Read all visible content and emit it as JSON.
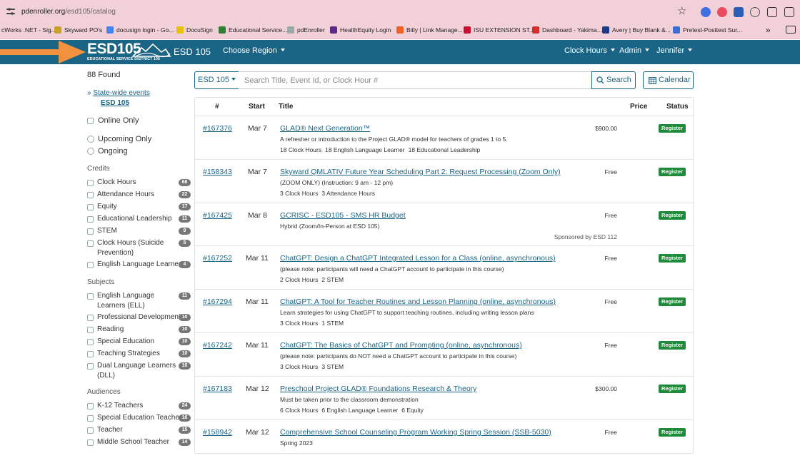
{
  "browser": {
    "url_host": "pdenroller.org",
    "url_path": "/esd105/catalog",
    "bookmarks": [
      {
        "label": "cWorks .NET - Sig...",
        "color": "#666"
      },
      {
        "label": "Skyward PO's",
        "color": "#c8a02a"
      },
      {
        "label": "docusign login - Go...",
        "color": "#4285f4"
      },
      {
        "label": "DocuSign",
        "color": "#e6c200"
      },
      {
        "label": "Educational Service...",
        "color": "#2e7d32"
      },
      {
        "label": "pdEnroller",
        "color": "#9aa"
      },
      {
        "label": "HealthEquity Login",
        "color": "#5b2a86"
      },
      {
        "label": "Bitly | Link Manage...",
        "color": "#ee6123"
      },
      {
        "label": "ISU EXTENSION ST...",
        "color": "#c8102e"
      },
      {
        "label": "Dashboard - Yakima...",
        "color": "#d32f2f"
      },
      {
        "label": "Avery | Buy Blank &...",
        "color": "#1b3a8a"
      },
      {
        "label": "Pretest-Posttest Sur...",
        "color": "#3b6fd6"
      }
    ]
  },
  "nav": {
    "logo_text": "ESD105",
    "logo_subtitle": "EDUCATIONAL SERVICE DISTRICT 105",
    "brand": "ESD 105",
    "choose_region": "Choose Region",
    "clock_hours": "Clock Hours",
    "admin": "Admin",
    "user": "Jennifer"
  },
  "sidebar": {
    "found": "88 Found",
    "statewide": "State-wide events",
    "esd105": "ESD 105",
    "online_only": "Online Only",
    "upcoming_only": "Upcoming Only",
    "ongoing": "Ongoing",
    "credits_title": "Credits",
    "credits": [
      {
        "label": "Clock Hours",
        "count": "68"
      },
      {
        "label": "Attendance Hours",
        "count": "22"
      },
      {
        "label": "Equity",
        "count": "17"
      },
      {
        "label": "Educational Leadership",
        "count": "11"
      },
      {
        "label": "STEM",
        "count": "9"
      },
      {
        "label": "Clock Hours (Suicide",
        "label2": "Prevention)",
        "count": "5"
      },
      {
        "label": "English Language Learner",
        "count": "4"
      }
    ],
    "subjects_title": "Subjects",
    "subjects": [
      {
        "label": "English Language",
        "label2": "Learners (ELL)",
        "count": "11"
      },
      {
        "label": "Professional Development",
        "count": "10"
      },
      {
        "label": "Reading",
        "count": "10"
      },
      {
        "label": "Special Education",
        "count": "10"
      },
      {
        "label": "Teaching Strategies",
        "count": "10"
      },
      {
        "label": "Dual Language Learners",
        "label2": "(DLL)",
        "count": "10"
      }
    ],
    "audiences_title": "Audiences",
    "audiences": [
      {
        "label": "K-12 Teachers",
        "count": "24"
      },
      {
        "label": "Special Education Teacher",
        "count": "16"
      },
      {
        "label": "Teacher",
        "count": "15"
      },
      {
        "label": "Middle School Teacher",
        "count": "14"
      }
    ]
  },
  "search": {
    "scope": "ESD 105",
    "placeholder": "Search Title, Event Id, or Clock Hour #",
    "search_label": "Search",
    "calendar_label": "Calendar"
  },
  "table": {
    "headers": {
      "num": "#",
      "start": "Start",
      "title": "Title",
      "price": "Price",
      "status": "Status"
    },
    "rows": [
      {
        "id": "#167376",
        "start": "Mar 7",
        "title": "GLAD® Next Generation™",
        "desc": "A refresher or introduction to the Project GLAD® model for teachers of grades 1 to 5.",
        "tags": [
          "18 Clock Hours",
          "18 English Language Learner",
          "18 Educational Leadership"
        ],
        "price": "$900.00",
        "status": "Register"
      },
      {
        "id": "#158343",
        "start": "Mar 7",
        "title": "Skyward QMLATIV Future Year Scheduling Part 2: Request Processing (Zoom Only)",
        "desc": "(ZOOM ONLY) (Instruction: 9 am - 12 pm)",
        "tags": [
          "3 Clock Hours",
          "3 Attendance Hours"
        ],
        "price": "Free",
        "status": "Register"
      },
      {
        "id": "#167425",
        "start": "Mar 8",
        "title": "GCRISC - ESD105 - SMS HR Budget",
        "desc": "Hybrid (Zoom/In-Person at ESD 105)",
        "tags": [],
        "sponsor": "Sponsored by ESD 112",
        "price": "Free",
        "status": "Register"
      },
      {
        "id": "#167252",
        "start": "Mar 11",
        "title": "ChatGPT: Design a ChatGPT Integrated Lesson for a Class (online, asynchronous)",
        "desc": "(please note: participants will need a ChatGPT account to participate in this course)",
        "tags": [
          "2 Clock Hours",
          "2 STEM"
        ],
        "price": "Free",
        "status": "Register"
      },
      {
        "id": "#167294",
        "start": "Mar 11",
        "title": "ChatGPT: A Tool for Teacher Routines and Lesson Planning (online, asynchronous)",
        "desc": "Learn strategies for using ChatGPT to support teaching routines, including writing lesson plans",
        "tags": [
          "3 Clock Hours",
          "1 STEM"
        ],
        "price": "Free",
        "status": "Register"
      },
      {
        "id": "#167242",
        "start": "Mar 11",
        "title": "ChatGPT: The Basics of ChatGPT and Prompting (online, asynchronous)",
        "desc": "(please note: participants do NOT need a ChatGPT account to participate in this course)",
        "tags": [
          "3 Clock Hours",
          "3 STEM"
        ],
        "price": "Free",
        "status": "Register"
      },
      {
        "id": "#167183",
        "start": "Mar 12",
        "title": "Preschool Project GLAD® Foundations Research & Theory",
        "desc": "Must be taken prior to the classroom demonstration",
        "tags": [
          "6 Clock Hours",
          "6 English Language Learner",
          "6 Equity"
        ],
        "price": "$300.00",
        "status": "Register"
      },
      {
        "id": "#158942",
        "start": "Mar 12",
        "title": "Comprehensive School Counseling Program Working Spring Session (SSB-5030)",
        "desc": "Spring 2023",
        "tags": [],
        "price": "Free",
        "status": "Register"
      }
    ]
  }
}
